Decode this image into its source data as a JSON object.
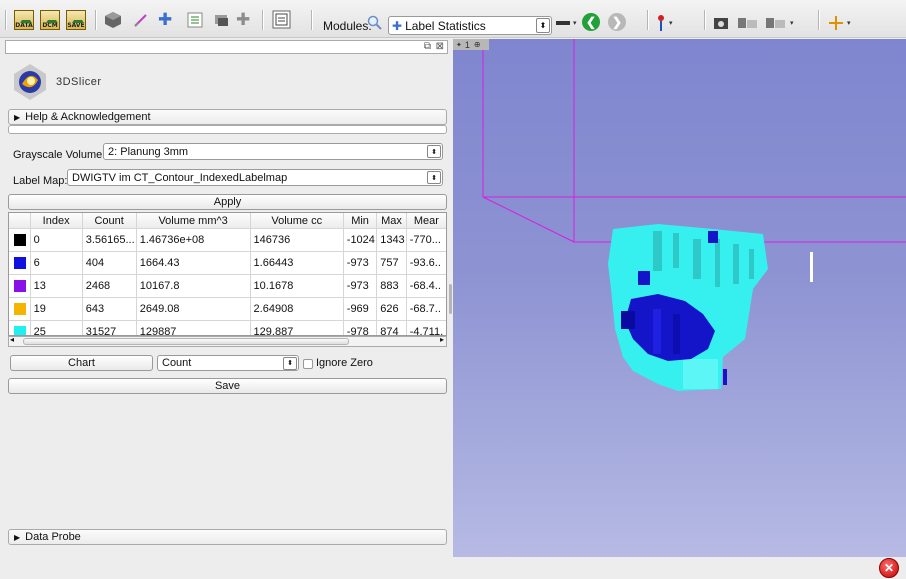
{
  "toolbar": {
    "data_label": "DATA",
    "dcm_label": "DCM",
    "save_label": "SAVE",
    "modules_label": "Modules:",
    "current_module": "Label Statistics"
  },
  "panel": {
    "logo_text": "3DSlicer",
    "help_section": "Help & Acknowledgement",
    "grayscale_label": "Grayscale Volume:",
    "grayscale_value": "2: Planung 3mm",
    "labelmap_label": "Label Map:",
    "labelmap_value": "DWIGTV im CT_Contour_IndexedLabelmap",
    "apply_label": "Apply",
    "table": {
      "headers": [
        "",
        "Index",
        "Count",
        "Volume mm^3",
        "Volume cc",
        "Min",
        "Max",
        "Mear"
      ],
      "rows": [
        {
          "color": "#000000",
          "index": "0",
          "count": "3.56165...",
          "vol_mm": "1.46736e+08",
          "vol_cc": "146736",
          "min": "-1024",
          "max": "1343",
          "mean": "-770..."
        },
        {
          "color": "#1010e0",
          "index": "6",
          "count": "404",
          "vol_mm": "1664.43",
          "vol_cc": "1.66443",
          "min": "-973",
          "max": "757",
          "mean": "-93.6.."
        },
        {
          "color": "#8a10e8",
          "index": "13",
          "count": "2468",
          "vol_mm": "10167.8",
          "vol_cc": "10.1678",
          "min": "-973",
          "max": "883",
          "mean": "-68.4.."
        },
        {
          "color": "#f4b400",
          "index": "19",
          "count": "643",
          "vol_mm": "2649.08",
          "vol_cc": "2.64908",
          "min": "-969",
          "max": "626",
          "mean": "-68.7.."
        },
        {
          "color": "#20f0f0",
          "index": "25",
          "count": "31527",
          "vol_mm": "129887",
          "vol_cc": "129.887",
          "min": "-978",
          "max": "874",
          "mean": "-4.711."
        }
      ]
    },
    "chart_button": "Chart",
    "chart_metric": "Count",
    "ignore_zero_label": "Ignore Zero",
    "save_button": "Save",
    "data_probe": "Data Probe"
  },
  "view3d": {
    "view_number": "1"
  },
  "colors": {
    "box_outline": "#d81ee0",
    "label_cyan": "#36f0f0",
    "label_blue": "#1414c8"
  }
}
